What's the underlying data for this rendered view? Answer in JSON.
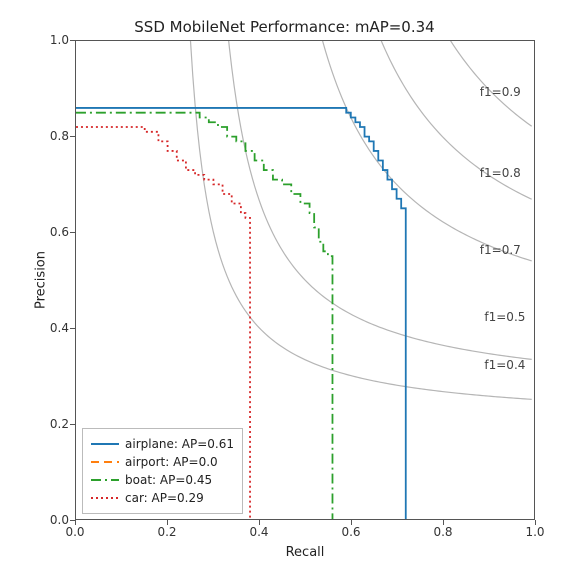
{
  "chart_data": {
    "type": "line",
    "title": "SSD MobileNet Performance:  mAP=0.34",
    "xlabel": "Recall",
    "ylabel": "Precision",
    "xlim": [
      0.0,
      1.0
    ],
    "ylim": [
      0.0,
      1.0
    ],
    "xticks": [
      0.0,
      0.2,
      0.4,
      0.6,
      0.8,
      1.0
    ],
    "yticks": [
      0.0,
      0.2,
      0.4,
      0.6,
      0.8,
      1.0
    ],
    "iso_f1": [
      0.4,
      0.5,
      0.7,
      0.8,
      0.9
    ],
    "iso_f1_labels": [
      "f1=0.4",
      "f1=0.5",
      "f1=0.7",
      "f1=0.8",
      "f1=0.9"
    ],
    "series": [
      {
        "name": "airplane: AP=0.61",
        "color": "#1f77b4",
        "dash": "solid",
        "x": [
          0.0,
          0.55,
          0.56,
          0.58,
          0.59,
          0.6,
          0.61,
          0.62,
          0.63,
          0.64,
          0.65,
          0.66,
          0.67,
          0.68,
          0.69,
          0.7,
          0.71,
          0.72,
          0.72
        ],
        "y": [
          0.86,
          0.86,
          0.86,
          0.86,
          0.85,
          0.84,
          0.83,
          0.82,
          0.8,
          0.79,
          0.77,
          0.75,
          0.73,
          0.71,
          0.69,
          0.67,
          0.65,
          0.61,
          0.0
        ]
      },
      {
        "name": "airport: AP=0.0",
        "color": "#ff7f0e",
        "dash": "8,5",
        "x": [
          0.0
        ],
        "y": [
          0.0
        ]
      },
      {
        "name": "boat: AP=0.45",
        "color": "#2ca02c",
        "dash": "10,4,2,4",
        "x": [
          0.0,
          0.25,
          0.27,
          0.29,
          0.31,
          0.33,
          0.35,
          0.37,
          0.39,
          0.41,
          0.43,
          0.45,
          0.47,
          0.49,
          0.51,
          0.52,
          0.53,
          0.54,
          0.55,
          0.56,
          0.56,
          0.56
        ],
        "y": [
          0.85,
          0.85,
          0.84,
          0.83,
          0.82,
          0.8,
          0.79,
          0.77,
          0.75,
          0.73,
          0.71,
          0.7,
          0.68,
          0.66,
          0.64,
          0.61,
          0.58,
          0.56,
          0.55,
          0.53,
          0.3,
          0.0
        ]
      },
      {
        "name": "car: AP=0.29",
        "color": "#d62728",
        "dash": "2,3",
        "x": [
          0.0,
          0.05,
          0.1,
          0.12,
          0.15,
          0.18,
          0.2,
          0.22,
          0.24,
          0.26,
          0.28,
          0.3,
          0.32,
          0.34,
          0.36,
          0.37,
          0.38,
          0.38,
          0.38,
          0.38
        ],
        "y": [
          0.82,
          0.82,
          0.82,
          0.82,
          0.81,
          0.79,
          0.77,
          0.75,
          0.73,
          0.72,
          0.71,
          0.7,
          0.68,
          0.66,
          0.64,
          0.63,
          0.62,
          0.42,
          0.2,
          0.0
        ]
      }
    ]
  }
}
